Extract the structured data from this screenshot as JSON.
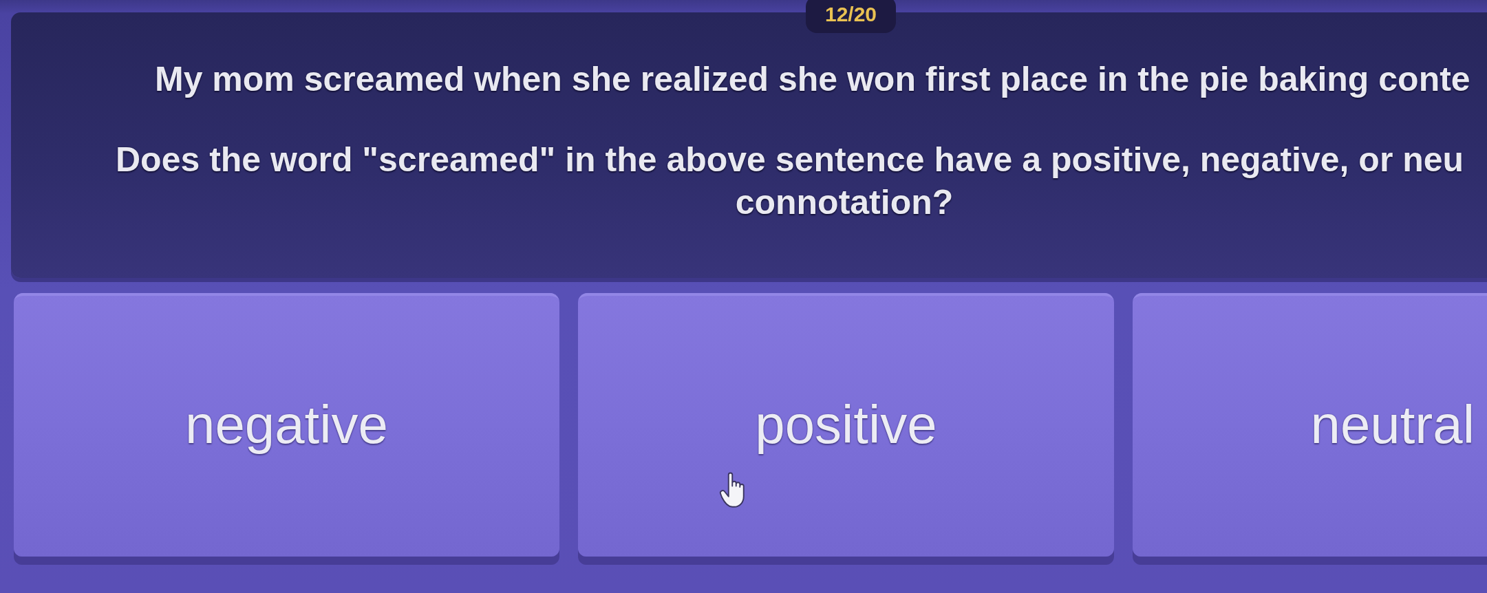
{
  "progress": {
    "counter": "12/20"
  },
  "question": {
    "sentence": "My mom screamed when she realized she won first place in the pie baking conte",
    "prompt_lines": [
      "Does the word \"screamed\" in the above sentence have a positive, negative, or neu",
      "connotation?"
    ]
  },
  "answers": [
    {
      "label": "negative",
      "selected": false
    },
    {
      "label": "positive",
      "selected": false
    },
    {
      "label": "neutral",
      "selected": false
    }
  ]
}
